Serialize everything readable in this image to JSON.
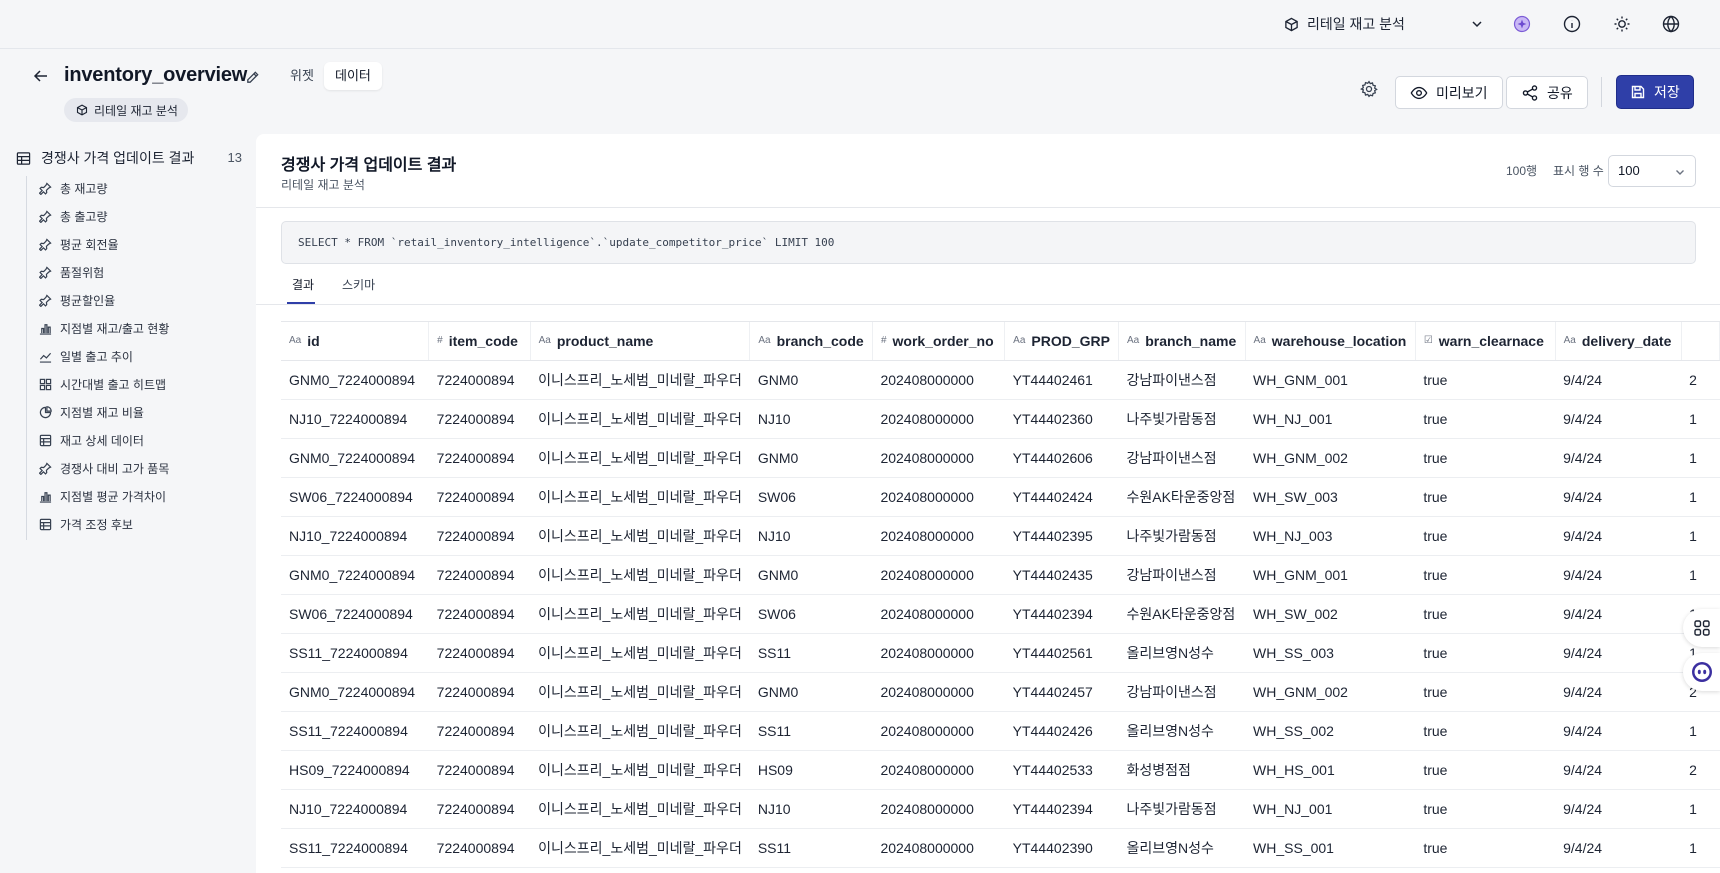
{
  "topbar": {
    "project_name": "리테일 재고 분석",
    "icons": [
      "cube-icon",
      "chevron-down-icon",
      "ai-sparkle-icon",
      "info-icon",
      "sun-icon",
      "globe-icon"
    ]
  },
  "header": {
    "title": "inventory_overview",
    "tabs": [
      {
        "label": "위젯",
        "active": false
      },
      {
        "label": "데이터",
        "active": true
      }
    ],
    "project_badge": "리테일 재고 분석",
    "buttons": {
      "preview": "미리보기",
      "share": "공유",
      "save": "저장"
    },
    "accent_color": "#2f3fa8"
  },
  "sidebar": {
    "dataset_title": "경쟁사 가격 업데이트 결과",
    "count": "13",
    "items": [
      {
        "label": "총 재고량",
        "icon": "pin-icon"
      },
      {
        "label": "총 출고량",
        "icon": "pin-icon"
      },
      {
        "label": "평균 회전율",
        "icon": "pin-icon"
      },
      {
        "label": "품절위험",
        "icon": "pin-icon"
      },
      {
        "label": "평균할인율",
        "icon": "pin-icon"
      },
      {
        "label": "지점별 재고/출고 현황",
        "icon": "bar-chart-icon"
      },
      {
        "label": "일별 출고 추이",
        "icon": "line-chart-icon"
      },
      {
        "label": "시간대별 출고 히트맵",
        "icon": "heatmap-icon"
      },
      {
        "label": "지점별 재고 비율",
        "icon": "pie-chart-icon"
      },
      {
        "label": "재고 상세 데이터",
        "icon": "table-icon"
      },
      {
        "label": "경쟁사 대비 고가 품목",
        "icon": "pin-icon"
      },
      {
        "label": "지점별 평균 가격차이",
        "icon": "bar-chart-icon"
      },
      {
        "label": "가격 조정 후보",
        "icon": "table-icon"
      }
    ]
  },
  "main": {
    "title": "경쟁사 가격 업데이트 결과",
    "subtitle": "리테일 재고 분석",
    "row_count": "100행",
    "rows_label": "표시 행 수",
    "rows_value": "100",
    "sql": "SELECT * FROM `retail_inventory_intelligence`.`update_competitor_price` LIMIT 100",
    "tabs": [
      {
        "label": "결과",
        "active": true
      },
      {
        "label": "스키마",
        "active": false
      }
    ]
  },
  "table": {
    "columns": [
      {
        "name": "id",
        "type": "Aa"
      },
      {
        "name": "item_code",
        "type": "#"
      },
      {
        "name": "product_name",
        "type": "Aa"
      },
      {
        "name": "branch_code",
        "type": "Aa"
      },
      {
        "name": "work_order_no",
        "type": "#"
      },
      {
        "name": "PROD_GRP",
        "type": "Aa"
      },
      {
        "name": "branch_name",
        "type": "Aa"
      },
      {
        "name": "warehouse_location",
        "type": "Aa"
      },
      {
        "name": "warn_clearnace",
        "type": "☑"
      },
      {
        "name": "delivery_date",
        "type": "Aa"
      },
      {
        "name": "",
        "type": ""
      }
    ],
    "rows": [
      [
        "GNM0_7224000894",
        "7224000894",
        "이니스프리_노세범_미네랄_파우더",
        "GNM0",
        "202408000000",
        "YT44402461",
        "강남파이낸스점",
        "WH_GNM_001",
        "true",
        "9/4/24",
        "2"
      ],
      [
        "NJ10_7224000894",
        "7224000894",
        "이니스프리_노세범_미네랄_파우더",
        "NJ10",
        "202408000000",
        "YT44402360",
        "나주빛가람동점",
        "WH_NJ_001",
        "true",
        "9/4/24",
        "1"
      ],
      [
        "GNM0_7224000894",
        "7224000894",
        "이니스프리_노세범_미네랄_파우더",
        "GNM0",
        "202408000000",
        "YT44402606",
        "강남파이낸스점",
        "WH_GNM_002",
        "true",
        "9/4/24",
        "1"
      ],
      [
        "SW06_7224000894",
        "7224000894",
        "이니스프리_노세범_미네랄_파우더",
        "SW06",
        "202408000000",
        "YT44402424",
        "수원AK타운중앙점",
        "WH_SW_003",
        "true",
        "9/4/24",
        "1"
      ],
      [
        "NJ10_7224000894",
        "7224000894",
        "이니스프리_노세범_미네랄_파우더",
        "NJ10",
        "202408000000",
        "YT44402395",
        "나주빛가람동점",
        "WH_NJ_003",
        "true",
        "9/4/24",
        "1"
      ],
      [
        "GNM0_7224000894",
        "7224000894",
        "이니스프리_노세범_미네랄_파우더",
        "GNM0",
        "202408000000",
        "YT44402435",
        "강남파이낸스점",
        "WH_GNM_001",
        "true",
        "9/4/24",
        "1"
      ],
      [
        "SW06_7224000894",
        "7224000894",
        "이니스프리_노세범_미네랄_파우더",
        "SW06",
        "202408000000",
        "YT44402394",
        "수원AK타운중앙점",
        "WH_SW_002",
        "true",
        "9/4/24",
        "1"
      ],
      [
        "SS11_7224000894",
        "7224000894",
        "이니스프리_노세범_미네랄_파우더",
        "SS11",
        "202408000000",
        "YT44402561",
        "올리브영N성수",
        "WH_SS_003",
        "true",
        "9/4/24",
        "1"
      ],
      [
        "GNM0_7224000894",
        "7224000894",
        "이니스프리_노세범_미네랄_파우더",
        "GNM0",
        "202408000000",
        "YT44402457",
        "강남파이낸스점",
        "WH_GNM_002",
        "true",
        "9/4/24",
        "2"
      ],
      [
        "SS11_7224000894",
        "7224000894",
        "이니스프리_노세범_미네랄_파우더",
        "SS11",
        "202408000000",
        "YT44402426",
        "올리브영N성수",
        "WH_SS_002",
        "true",
        "9/4/24",
        "1"
      ],
      [
        "HS09_7224000894",
        "7224000894",
        "이니스프리_노세범_미네랄_파우더",
        "HS09",
        "202408000000",
        "YT44402533",
        "화성병점점",
        "WH_HS_001",
        "true",
        "9/4/24",
        "2"
      ],
      [
        "NJ10_7224000894",
        "7224000894",
        "이니스프리_노세범_미네랄_파우더",
        "NJ10",
        "202408000000",
        "YT44402394",
        "나주빛가람동점",
        "WH_NJ_001",
        "true",
        "9/4/24",
        "1"
      ],
      [
        "SS11_7224000894",
        "7224000894",
        "이니스프리_노세범_미네랄_파우더",
        "SS11",
        "202408000000",
        "YT44402390",
        "올리브영N성수",
        "WH_SS_001",
        "true",
        "9/4/24",
        "1"
      ]
    ]
  },
  "floating": [
    "apps-grid-icon",
    "assistant-bot-icon"
  ]
}
